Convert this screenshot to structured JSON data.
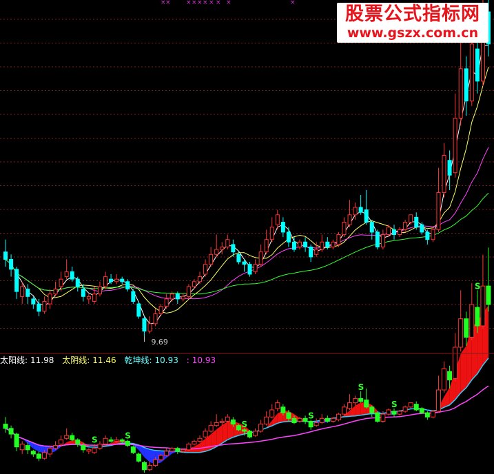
{
  "watermark": {
    "line1": "股票公式指标网",
    "line2": "www.gszx.com.cn"
  },
  "indicator_bar": {
    "items": [
      {
        "label": "太阳线:",
        "value": "11.98",
        "color": "#ffffff"
      },
      {
        "label": "太阴线:",
        "value": "11.46",
        "color": "#ffff66"
      },
      {
        "label": "乾坤线:",
        "value": "10.93",
        "color": "#66ffff"
      },
      {
        "label": ":",
        "value": "10.93",
        "color": "#ff44ff"
      }
    ]
  },
  "colors": {
    "up": "#ff3333",
    "down": "#00ffff",
    "ma1": "#ffffff",
    "ma2": "#ffff66",
    "ma3": "#ff44ff",
    "ma4": "#33ff33",
    "grid": "#7a1f1f"
  },
  "chart_data": {
    "type": "candlestick",
    "low_annotation": "9.69",
    "signal_label": "S",
    "candles": [
      [
        13.1,
        12.8,
        13.6,
        12.5
      ],
      [
        12.8,
        12.4,
        13.0,
        12.1
      ],
      [
        12.4,
        11.5,
        12.5,
        11.2
      ],
      [
        11.3,
        11.7,
        11.9,
        11.0
      ],
      [
        11.6,
        11.3,
        11.8,
        11.0
      ],
      [
        11.2,
        11.0,
        11.3,
        10.8
      ],
      [
        11.0,
        10.7,
        11.2,
        10.5
      ],
      [
        10.7,
        11.1,
        11.3,
        10.6
      ],
      [
        11.0,
        11.4,
        11.6,
        10.8
      ],
      [
        11.4,
        11.6,
        11.9,
        11.3
      ],
      [
        11.7,
        12.0,
        12.3,
        11.5
      ],
      [
        12.1,
        12.3,
        12.8,
        12.0
      ],
      [
        12.3,
        12.0,
        12.5,
        11.9
      ],
      [
        12.0,
        11.7,
        12.1,
        11.5
      ],
      [
        11.6,
        11.3,
        11.8,
        11.1
      ],
      [
        11.2,
        11.3,
        11.4,
        11.0
      ],
      [
        11.1,
        11.4,
        11.7,
        11.0
      ],
      [
        11.4,
        11.7,
        11.9,
        11.3
      ],
      [
        11.7,
        12.1,
        12.3,
        11.6
      ],
      [
        12.0,
        11.9,
        12.2,
        11.8
      ],
      [
        11.9,
        12.0,
        12.2,
        11.8
      ],
      [
        12.0,
        11.9,
        12.1,
        11.8
      ],
      [
        11.9,
        11.6,
        12.0,
        11.5
      ],
      [
        11.5,
        11.1,
        11.6,
        11.0
      ],
      [
        11.0,
        10.5,
        11.1,
        10.4
      ],
      [
        10.4,
        9.9,
        10.5,
        9.69
      ],
      [
        9.9,
        10.2,
        10.5,
        9.8
      ],
      [
        10.2,
        10.6,
        10.8,
        10.1
      ],
      [
        10.6,
        10.9,
        11.0,
        10.5
      ],
      [
        10.9,
        11.2,
        11.4,
        10.8
      ],
      [
        11.2,
        11.4,
        11.5,
        11.1
      ],
      [
        11.4,
        11.2,
        11.5,
        11.0
      ],
      [
        11.2,
        11.3,
        11.4,
        11.1
      ],
      [
        11.3,
        11.7,
        11.8,
        11.2
      ],
      [
        11.7,
        11.9,
        12.0,
        11.6
      ],
      [
        11.9,
        12.1,
        12.3,
        11.8
      ],
      [
        12.2,
        12.6,
        12.8,
        12.1
      ],
      [
        12.6,
        13.0,
        13.3,
        12.5
      ],
      [
        13.0,
        13.2,
        13.8,
        12.9
      ],
      [
        13.2,
        13.3,
        13.5,
        13.0
      ],
      [
        13.3,
        13.6,
        13.8,
        13.2
      ],
      [
        13.4,
        13.1,
        13.6,
        12.9
      ],
      [
        13.0,
        12.7,
        13.1,
        12.6
      ],
      [
        12.7,
        12.6,
        12.8,
        12.3
      ],
      [
        12.6,
        12.2,
        12.7,
        12.1
      ],
      [
        12.3,
        12.6,
        12.8,
        12.2
      ],
      [
        12.6,
        13.1,
        13.4,
        12.5
      ],
      [
        13.1,
        13.6,
        14.0,
        13.0
      ],
      [
        13.6,
        14.1,
        14.5,
        13.5
      ],
      [
        14.2,
        14.6,
        14.8,
        14.0
      ],
      [
        14.3,
        13.9,
        14.5,
        13.7
      ],
      [
        13.9,
        13.5,
        14.1,
        13.3
      ],
      [
        13.5,
        13.2,
        13.7,
        13.1
      ],
      [
        13.3,
        13.5,
        13.6,
        13.2
      ],
      [
        13.5,
        13.3,
        13.7,
        13.1
      ],
      [
        13.3,
        12.9,
        13.4,
        12.7
      ],
      [
        13.0,
        13.2,
        13.5,
        12.9
      ],
      [
        13.2,
        13.5,
        13.8,
        13.1
      ],
      [
        13.5,
        13.3,
        13.7,
        13.2
      ],
      [
        13.3,
        13.5,
        13.6,
        13.2
      ],
      [
        13.4,
        13.8,
        13.9,
        13.3
      ],
      [
        13.8,
        14.3,
        14.5,
        13.7
      ],
      [
        14.2,
        14.6,
        15.2,
        14.1
      ],
      [
        14.6,
        14.9,
        15.1,
        14.4
      ],
      [
        14.9,
        14.7,
        15.4,
        14.6
      ],
      [
        14.8,
        14.3,
        15.6,
        14.2
      ],
      [
        14.3,
        13.9,
        14.4,
        13.6
      ],
      [
        13.9,
        13.3,
        14.0,
        13.2
      ],
      [
        13.3,
        13.8,
        14.0,
        13.2
      ],
      [
        13.8,
        14.1,
        14.2,
        13.7
      ],
      [
        14.0,
        13.8,
        14.2,
        13.6
      ],
      [
        13.8,
        14.0,
        14.1,
        13.7
      ],
      [
        14.0,
        14.3,
        14.4,
        13.9
      ],
      [
        14.3,
        14.6,
        14.6,
        14.2
      ],
      [
        14.5,
        14.1,
        14.7,
        14.0
      ],
      [
        14.2,
        13.9,
        14.3,
        13.8
      ],
      [
        13.9,
        13.6,
        14.0,
        13.4
      ],
      [
        13.6,
        14.0,
        14.1,
        13.5
      ],
      [
        14.0,
        15.5,
        16.5,
        13.9
      ],
      [
        15.5,
        17.0,
        17.5,
        15.3
      ],
      [
        16.8,
        16.2,
        17.2,
        15.6
      ],
      [
        16.3,
        18.5,
        19.5,
        16.1
      ],
      [
        18.5,
        20.5,
        22.5,
        18.2
      ],
      [
        20.5,
        19.2,
        21.0,
        18.6
      ],
      [
        19.2,
        21.5,
        23.0,
        19.0
      ],
      [
        21.3,
        20.0,
        22.5,
        19.5
      ],
      [
        20.0,
        22.8,
        25.0,
        19.8
      ],
      [
        22.8,
        21.5,
        25.5,
        21.0
      ]
    ]
  }
}
